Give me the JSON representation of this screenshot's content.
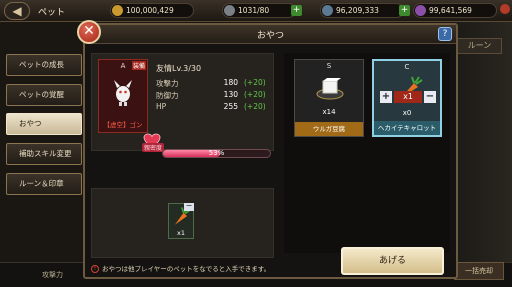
{
  "screen": {
    "back_label": "◀",
    "title": "ペット",
    "resources": {
      "gold": "100,000,429",
      "stamina": "1031/80",
      "currency1": "96,209,333",
      "currency2": "99,641,569"
    },
    "right_tab": "ルーン",
    "bottom_button": "一括売却",
    "bottom_status": "攻撃力"
  },
  "side_menu": [
    {
      "label": "ペットの成長",
      "active": false
    },
    {
      "label": "ペットの覚醒",
      "active": false
    },
    {
      "label": "おやつ",
      "active": true
    },
    {
      "label": "補助スキル変更",
      "active": false
    },
    {
      "label": "ルーン＆印章",
      "active": false
    }
  ],
  "modal": {
    "title": "おやつ",
    "close_label": "✕",
    "help_label": "?",
    "pet": {
      "grade": "A",
      "equip_tag": "装備",
      "name": "【虚空】ゴン",
      "level_title": "友情Lv.3/30",
      "stats": [
        {
          "label": "攻撃力",
          "value": "180",
          "delta": "(+20)"
        },
        {
          "label": "防御力",
          "value": "130",
          "delta": "(+20)"
        },
        {
          "label": "HP",
          "value": "255",
          "delta": "(+20)"
        }
      ],
      "affinity_label": "親密度",
      "affinity_percent": 53,
      "affinity_text": "53%"
    },
    "selected": {
      "minus": "−",
      "count": "x1"
    },
    "items": [
      {
        "grade": "S",
        "qty": "x14",
        "name": "ウルガ豆腐",
        "selected": false
      },
      {
        "grade": "C",
        "qty": "x0",
        "name": "ヘカイテキャロット",
        "selected": true,
        "stepper_value": "x1"
      }
    ],
    "notice": "おやつは他プレイヤーのペットをなでると入手できます。",
    "notice_icon": "!",
    "give_label": "あげる"
  },
  "colors": {
    "accent": "#d3bd8a",
    "affinity": "#d8305a",
    "stat_bonus": "#62c94a"
  }
}
